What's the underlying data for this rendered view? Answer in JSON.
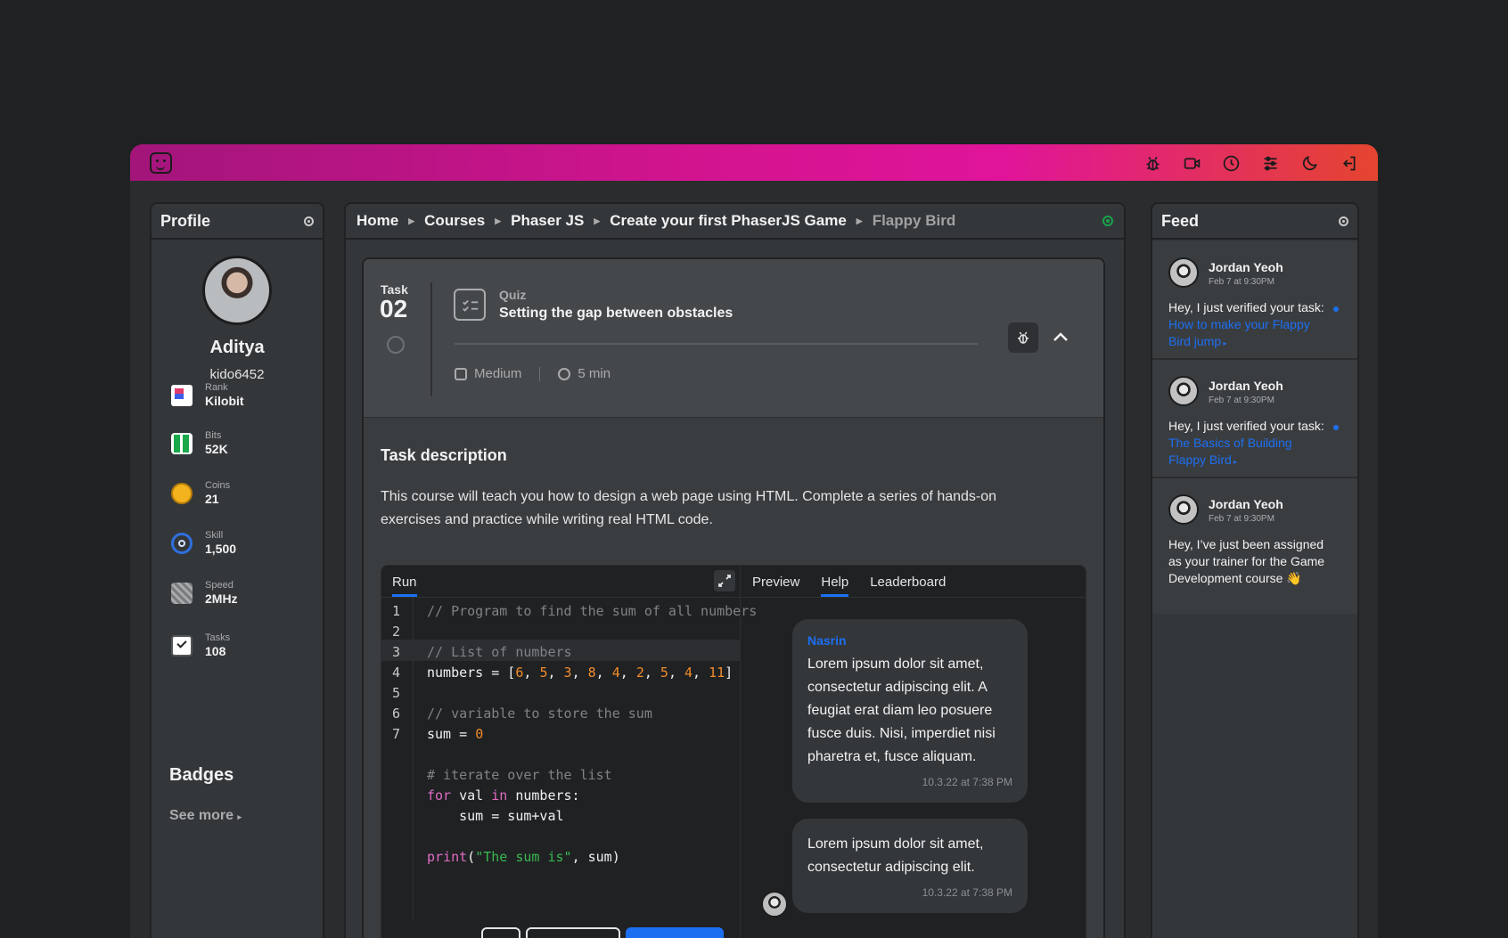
{
  "topbar": {
    "icons": [
      "logo-icon",
      "bug-icon",
      "video-icon",
      "clock-icon",
      "sliders-icon",
      "moon-icon",
      "logout-icon"
    ]
  },
  "profile": {
    "title": "Profile",
    "name": "Aditya",
    "username": "kido6452",
    "stats": [
      {
        "label": "Rank",
        "value": "Kilobit",
        "icon": "rank-icon"
      },
      {
        "label": "Bits",
        "value": "52K",
        "icon": "bits-icon"
      },
      {
        "label": "Coins",
        "value": "21",
        "icon": "coin-icon"
      },
      {
        "label": "Skill",
        "value": "1,500",
        "icon": "skill-icon"
      },
      {
        "label": "Speed",
        "value": "2MHz",
        "icon": "speed-icon"
      },
      {
        "label": "Tasks",
        "value": "108",
        "icon": "tasks-icon"
      }
    ],
    "badges_title": "Badges",
    "see_more": "See more"
  },
  "breadcrumb": [
    "Home",
    "Courses",
    "Phaser JS",
    "Create your first PhaserJS Game",
    "Flappy Bird"
  ],
  "task": {
    "label": "Task",
    "number": "02",
    "type": "Quiz",
    "title": "Setting the gap between obstacles",
    "difficulty": "Medium",
    "duration": "5 min",
    "desc_title": "Task description",
    "desc_body": "This course will teach you how to design a web page using HTML. Complete a series of hands-on exercises and practice while writing real HTML code."
  },
  "editor": {
    "tab": "Run",
    "line_numbers": [
      "1",
      "2",
      "3",
      "4",
      "5",
      "6",
      "7"
    ],
    "code": {
      "l1": "// Program to find the sum of all numbers",
      "l3": "// List of numbers",
      "l4_var": "numbers = [",
      "l4_vals": [
        "6",
        "5",
        "3",
        "8",
        "4",
        "2",
        "5",
        "4",
        "11"
      ],
      "l6": "// variable to store the sum",
      "l7_var": "sum = ",
      "l7_val": "0",
      "l9": "# iterate over the list",
      "l10_kw1": "for",
      "l10_mid": " val ",
      "l10_kw2": "in",
      "l10_rest": " numbers:",
      "l11": "    sum = sum+val",
      "l13_fn": "print",
      "l13_str": "\"The sum is\"",
      "l13_rest": ", sum)"
    }
  },
  "right_tabs": [
    "Preview",
    "Help",
    "Leaderboard"
  ],
  "active_right_tab": "Help",
  "chat": [
    {
      "name": "Nasrin",
      "text": "Lorem ipsum dolor sit amet, consectetur adipiscing elit. A feugiat erat diam leo posuere fusce duis. Nisi, imperdiet nisi pharetra et, fusce aliquam.",
      "time": "10.3.22 at 7:38 PM"
    },
    {
      "text": "Lorem ipsum dolor sit amet, consectetur adipiscing elit.",
      "time": "10.3.22 at 7:38 PM"
    }
  ],
  "feed": {
    "title": "Feed",
    "items": [
      {
        "name": "Jordan Yeoh",
        "date": "Feb 7 at 9:30PM",
        "text": "Hey, I just verified your task: ",
        "link": "How to make your Flappy Bird jump",
        "unread": true
      },
      {
        "name": "Jordan Yeoh",
        "date": "Feb 7 at 9:30PM",
        "text": "Hey, I just verified your task: ",
        "link": "The Basics of Building Flappy Bird",
        "unread": true
      },
      {
        "name": "Jordan Yeoh",
        "date": "Feb 7 at 9:30PM",
        "text": "Hey, I’ve just been assigned as your trainer for the Game Development course 👋",
        "link": "",
        "unread": false
      }
    ]
  },
  "colors": {
    "accent": "#1d6ff2",
    "status_online": "#17a34a",
    "brand_gradient_start": "#a3157a",
    "brand_gradient_end": "#e5452f"
  }
}
